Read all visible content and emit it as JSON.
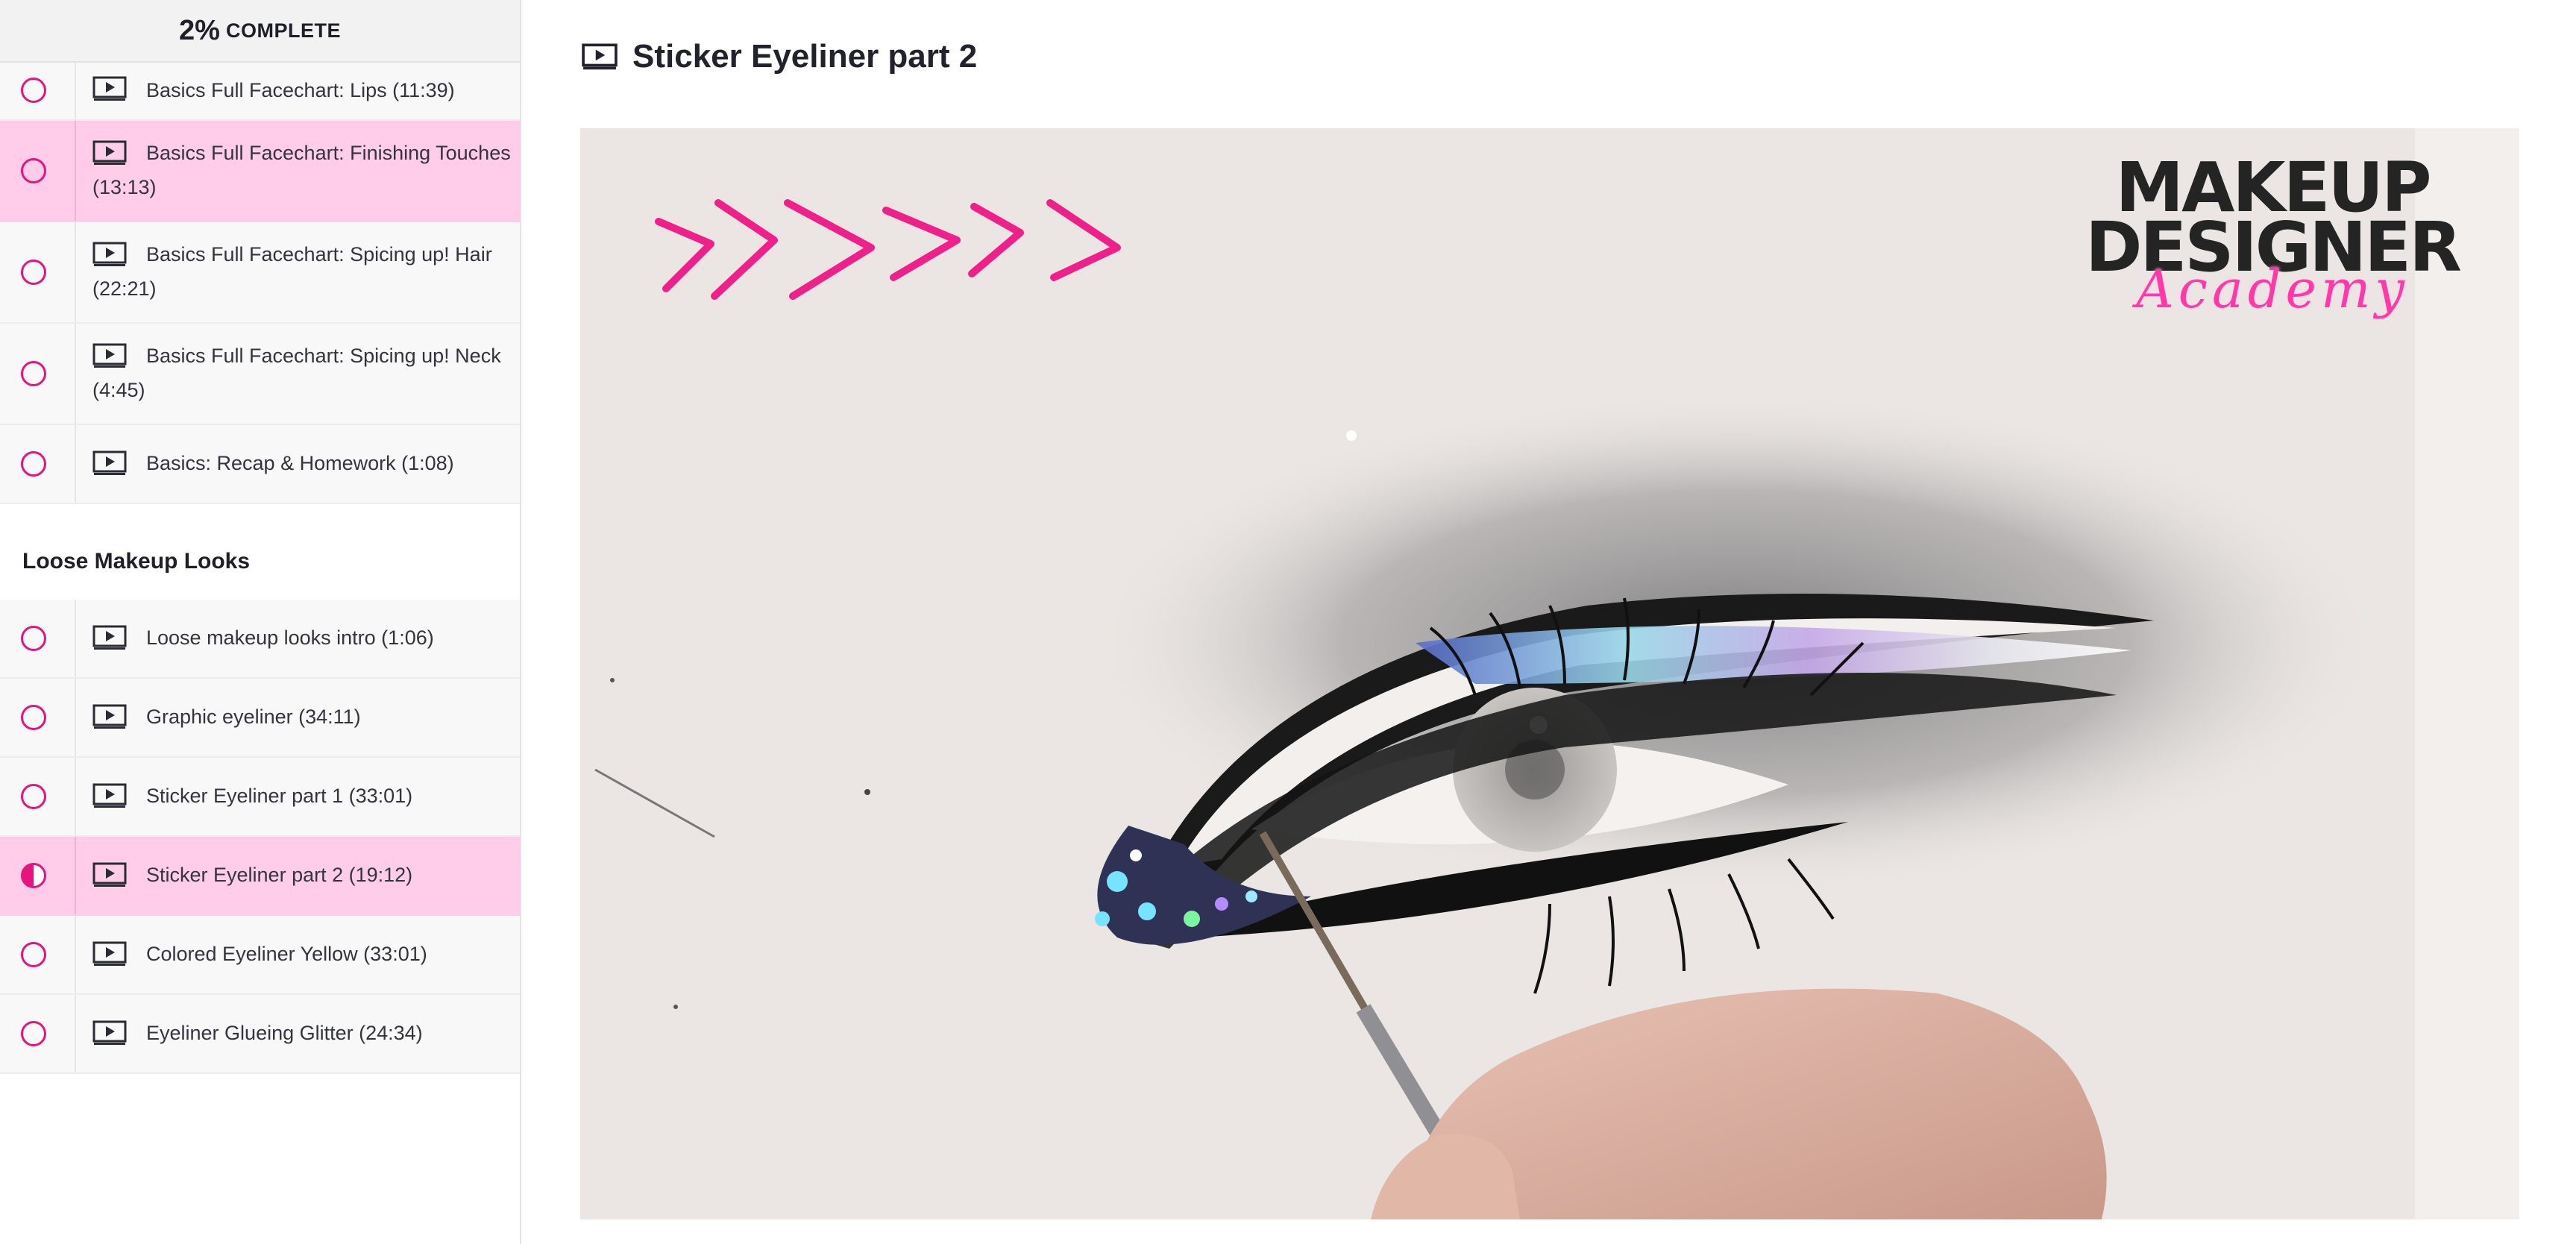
{
  "progress": {
    "percent": "2%",
    "label": "COMPLETE",
    "value": 0.02
  },
  "sidebar": {
    "items_top": [
      {
        "title": "Basics Full Facechart: Lips (11:39)",
        "status": "not-started"
      },
      {
        "title": "Basics Full Facechart: Finishing Touches (13:13)",
        "status": "not-started",
        "highlighted": true
      },
      {
        "title": "Basics Full Facechart: Spicing up! Hair (22:21)",
        "status": "not-started"
      },
      {
        "title": "Basics Full Facechart: Spicing up! Neck (4:45)",
        "status": "not-started"
      },
      {
        "title": "Basics: Recap & Homework (1:08)",
        "status": "not-started"
      }
    ],
    "section_title": "Loose Makeup Looks",
    "items_section": [
      {
        "title": "Loose makeup looks intro (1:06)",
        "status": "not-started"
      },
      {
        "title": "Graphic eyeliner (34:11)",
        "status": "not-started"
      },
      {
        "title": "Sticker Eyeliner part 1 (33:01)",
        "status": "not-started"
      },
      {
        "title": "Sticker Eyeliner part 2 (19:12)",
        "status": "in-progress",
        "active": true
      },
      {
        "title": "Colored Eyeliner Yellow (33:01)",
        "status": "not-started"
      },
      {
        "title": "Eyeliner Glueing Glitter (24:34)",
        "status": "not-started"
      }
    ]
  },
  "lecture": {
    "title": "Sticker Eyeliner part 2",
    "icon": "video-icon"
  },
  "video": {
    "logo_line1": "MAKEUP",
    "logo_line2": "DESIGNER",
    "logo_line3": "Academy"
  },
  "colors": {
    "accent": "#e6157e",
    "active_bg": "#ffcce9",
    "logo_pink": "#ff3aa8"
  }
}
